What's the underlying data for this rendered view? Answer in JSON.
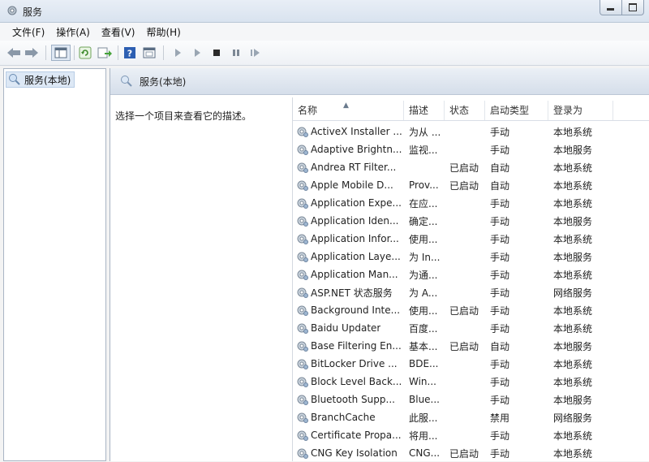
{
  "window": {
    "title": "服务"
  },
  "menu": [
    "文件(F)",
    "操作(A)",
    "查看(V)",
    "帮助(H)"
  ],
  "toolbar_icons": [
    "back-arrow-icon",
    "forward-arrow-icon",
    "show-hide-tree-icon",
    "refresh-icon",
    "export-list-icon",
    "help-icon",
    "properties-icon",
    "start-service-icon",
    "start-service-alt-icon",
    "stop-service-icon",
    "pause-service-icon",
    "resume-service-icon"
  ],
  "tree": {
    "root_label": "服务(本地)"
  },
  "main": {
    "header_title": "服务(本地)",
    "description": "选择一个项目来查看它的描述。"
  },
  "table": {
    "columns": [
      "名称",
      "描述",
      "状态",
      "启动类型",
      "登录为"
    ],
    "rows": [
      {
        "name": "ActiveX Installer ...",
        "desc": "为从 ...",
        "status": "",
        "start": "手动",
        "logon": "本地系统"
      },
      {
        "name": "Adaptive Brightn...",
        "desc": "监视...",
        "status": "",
        "start": "手动",
        "logon": "本地服务"
      },
      {
        "name": "Andrea RT Filter...",
        "desc": "",
        "status": "已启动",
        "start": "自动",
        "logon": "本地系统"
      },
      {
        "name": "Apple Mobile D...",
        "desc": "Prov...",
        "status": "已启动",
        "start": "自动",
        "logon": "本地系统"
      },
      {
        "name": "Application Expe...",
        "desc": "在应...",
        "status": "",
        "start": "手动",
        "logon": "本地系统"
      },
      {
        "name": "Application Iden...",
        "desc": "确定...",
        "status": "",
        "start": "手动",
        "logon": "本地服务"
      },
      {
        "name": "Application Infor...",
        "desc": "使用...",
        "status": "",
        "start": "手动",
        "logon": "本地系统"
      },
      {
        "name": "Application Laye...",
        "desc": "为 In...",
        "status": "",
        "start": "手动",
        "logon": "本地服务"
      },
      {
        "name": "Application Man...",
        "desc": "为通...",
        "status": "",
        "start": "手动",
        "logon": "本地系统"
      },
      {
        "name": "ASP.NET 状态服务",
        "desc": "为 A...",
        "status": "",
        "start": "手动",
        "logon": "网络服务"
      },
      {
        "name": "Background Inte...",
        "desc": "使用...",
        "status": "已启动",
        "start": "手动",
        "logon": "本地系统"
      },
      {
        "name": "Baidu Updater",
        "desc": "百度...",
        "status": "",
        "start": "手动",
        "logon": "本地系统"
      },
      {
        "name": "Base Filtering En...",
        "desc": "基本...",
        "status": "已启动",
        "start": "自动",
        "logon": "本地服务"
      },
      {
        "name": "BitLocker Drive ...",
        "desc": "BDE...",
        "status": "",
        "start": "手动",
        "logon": "本地系统"
      },
      {
        "name": "Block Level Back...",
        "desc": "Win...",
        "status": "",
        "start": "手动",
        "logon": "本地系统"
      },
      {
        "name": "Bluetooth Supp...",
        "desc": "Blue...",
        "status": "",
        "start": "手动",
        "logon": "本地服务"
      },
      {
        "name": "BranchCache",
        "desc": "此服...",
        "status": "",
        "start": "禁用",
        "logon": "网络服务"
      },
      {
        "name": "Certificate Propa...",
        "desc": "将用...",
        "status": "",
        "start": "手动",
        "logon": "本地系统"
      },
      {
        "name": "CNG Key Isolation",
        "desc": "CNG...",
        "status": "已启动",
        "start": "手动",
        "logon": "本地系统"
      }
    ]
  }
}
